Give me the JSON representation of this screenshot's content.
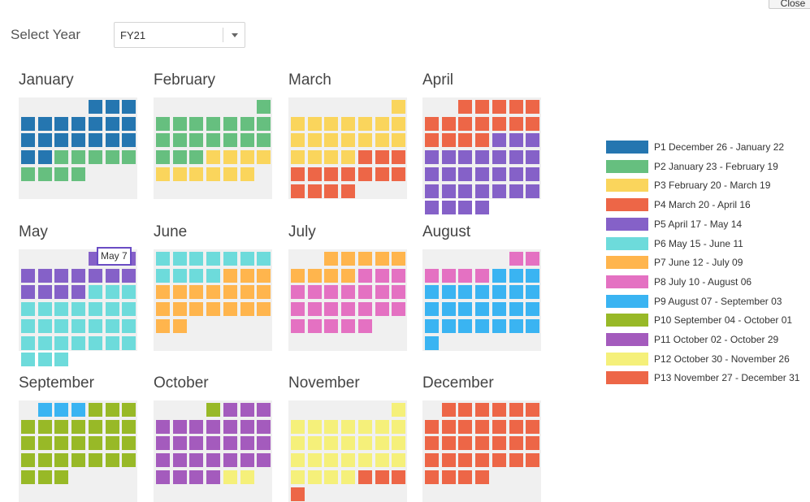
{
  "toolbar": {
    "close_label": "Close"
  },
  "select": {
    "label": "Select Year",
    "value": "FY21"
  },
  "tooltip": {
    "text": "May 7"
  },
  "months": [
    {
      "name": "January",
      "days": [
        "B",
        "B",
        "B",
        "B",
        "B",
        "B",
        "B",
        "B",
        "B",
        "B",
        "B",
        "B",
        "B",
        "B",
        "B",
        "B",
        "B",
        "B",
        "B",
        "G",
        "G",
        "G",
        "G",
        "G",
        "G",
        "G",
        "G",
        "G"
      ]
    },
    {
      "name": "February",
      "days": [
        "G",
        "G",
        "G",
        "G",
        "G",
        "G",
        "G",
        "G",
        "G",
        "G",
        "G",
        "G",
        "G",
        "G",
        "G",
        "G",
        "G",
        "G",
        "Y",
        "Y",
        "Y",
        "Y",
        "Y",
        "Y",
        "Y",
        "Y",
        "Y",
        "Y"
      ]
    },
    {
      "name": "March",
      "days": [
        "Y",
        "Y",
        "Y",
        "Y",
        "Y",
        "Y",
        "Y",
        "Y",
        "Y",
        "Y",
        "Y",
        "Y",
        "Y",
        "Y",
        "Y",
        "Y",
        "Y",
        "Y",
        "Y",
        "R",
        "R",
        "R",
        "R",
        "R",
        "R",
        "R",
        "R",
        "R",
        "R",
        "R",
        "R",
        "R",
        "R"
      ]
    },
    {
      "name": "April",
      "days": [
        "R",
        "R",
        "R",
        "R",
        "R",
        "R",
        "R",
        "R",
        "R",
        "R",
        "R",
        "R",
        "R",
        "R",
        "R",
        "R",
        "P",
        "P",
        "P",
        "P",
        "P",
        "P",
        "P",
        "P",
        "P",
        "P",
        "P",
        "P",
        "P",
        "P",
        "P",
        "P",
        "P",
        "P",
        "P",
        "P",
        "P",
        "P",
        "P",
        "P",
        "P",
        "P",
        "P",
        "P"
      ]
    },
    {
      "name": "May",
      "days": [
        "P",
        "P",
        "P",
        "P",
        "P",
        "P",
        "P",
        "P",
        "P",
        "P",
        "P",
        "P",
        "P",
        "P",
        "T",
        "T",
        "T",
        "T",
        "T",
        "T",
        "T",
        "T",
        "T",
        "T",
        "T",
        "T",
        "T",
        "T",
        "T",
        "T",
        "T",
        "T",
        "T",
        "T",
        "T",
        "T",
        "T",
        "T",
        "T",
        "T",
        "T"
      ]
    },
    {
      "name": "June",
      "days": [
        "T",
        "T",
        "T",
        "T",
        "T",
        "T",
        "T",
        "T",
        "T",
        "T",
        "T",
        "O",
        "O",
        "O",
        "O",
        "O",
        "O",
        "O",
        "O",
        "O",
        "O",
        "O",
        "O",
        "O",
        "O",
        "O",
        "O",
        "O",
        "O",
        "O"
      ]
    },
    {
      "name": "July",
      "days": [
        "O",
        "O",
        "O",
        "O",
        "O",
        "O",
        "O",
        "O",
        "O",
        "K",
        "K",
        "K",
        "K",
        "K",
        "K",
        "K",
        "K",
        "K",
        "K",
        "K",
        "K",
        "K",
        "K",
        "K",
        "K",
        "K",
        "K",
        "K",
        "K",
        "K",
        "K"
      ]
    },
    {
      "name": "August",
      "days": [
        "K",
        "K",
        "K",
        "K",
        "K",
        "K",
        "C",
        "C",
        "C",
        "C",
        "C",
        "C",
        "C",
        "C",
        "C",
        "C",
        "C",
        "C",
        "C",
        "C",
        "C",
        "C",
        "C",
        "C",
        "C",
        "C",
        "C",
        "C",
        "C",
        "C",
        "C"
      ]
    },
    {
      "name": "September",
      "days": [
        "C",
        "C",
        "C",
        "L",
        "L",
        "L",
        "L",
        "L",
        "L",
        "L",
        "L",
        "L",
        "L",
        "L",
        "L",
        "L",
        "L",
        "L",
        "L",
        "L",
        "L",
        "L",
        "L",
        "L",
        "L",
        "L",
        "L",
        "L",
        "L",
        "L"
      ]
    },
    {
      "name": "October",
      "days": [
        "L",
        "V",
        "V",
        "V",
        "V",
        "V",
        "V",
        "V",
        "V",
        "V",
        "V",
        "V",
        "V",
        "V",
        "V",
        "V",
        "V",
        "V",
        "V",
        "V",
        "V",
        "V",
        "V",
        "V",
        "V",
        "V",
        "V",
        "V",
        "V",
        "W",
        "W"
      ]
    },
    {
      "name": "November",
      "days": [
        "W",
        "W",
        "W",
        "W",
        "W",
        "W",
        "W",
        "W",
        "W",
        "W",
        "W",
        "W",
        "W",
        "W",
        "W",
        "W",
        "W",
        "W",
        "W",
        "W",
        "W",
        "W",
        "W",
        "W",
        "W",
        "W",
        "R",
        "R",
        "R",
        "R"
      ]
    },
    {
      "name": "December",
      "days": [
        "R",
        "R",
        "R",
        "R",
        "R",
        "R",
        "R",
        "R",
        "R",
        "R",
        "R",
        "R",
        "R",
        "R",
        "R",
        "R",
        "R",
        "R",
        "R",
        "R",
        "R",
        "R",
        "R",
        "R",
        "R",
        "R",
        "R",
        "R",
        "R",
        "R",
        "R"
      ]
    }
  ],
  "palette": {
    "B": "#2576b0",
    "G": "#66bf7f",
    "Y": "#fad55c",
    "R": "#ed6647",
    "P": "#8561c8",
    "T": "#6ddbdb",
    "O": "#ffb54d",
    "K": "#e471c2",
    "C": "#3ab4f2",
    "L": "#98b927",
    "V": "#a45bbd",
    "W": "#f5f07a"
  },
  "legend": [
    {
      "key": "B",
      "label": "P1 December 26 - January 22"
    },
    {
      "key": "G",
      "label": "P2 January 23 - February 19"
    },
    {
      "key": "Y",
      "label": "P3 February 20 - March 19"
    },
    {
      "key": "R",
      "label": "P4 March 20 - April 16"
    },
    {
      "key": "P",
      "label": "P5 April 17 - May 14"
    },
    {
      "key": "T",
      "label": "P6 May 15 - June 11"
    },
    {
      "key": "O",
      "label": "P7 June 12 - July 09"
    },
    {
      "key": "K",
      "label": "P8 July 10 - August 06"
    },
    {
      "key": "C",
      "label": "P9 August 07 - September 03"
    },
    {
      "key": "L",
      "label": "P10 September 04 - October 01"
    },
    {
      "key": "V",
      "label": "P11 October 02 - October 29"
    },
    {
      "key": "W",
      "label": "P12 October 30 - November 26"
    },
    {
      "key": "R",
      "label": "P13 November 27 - December 31"
    }
  ]
}
